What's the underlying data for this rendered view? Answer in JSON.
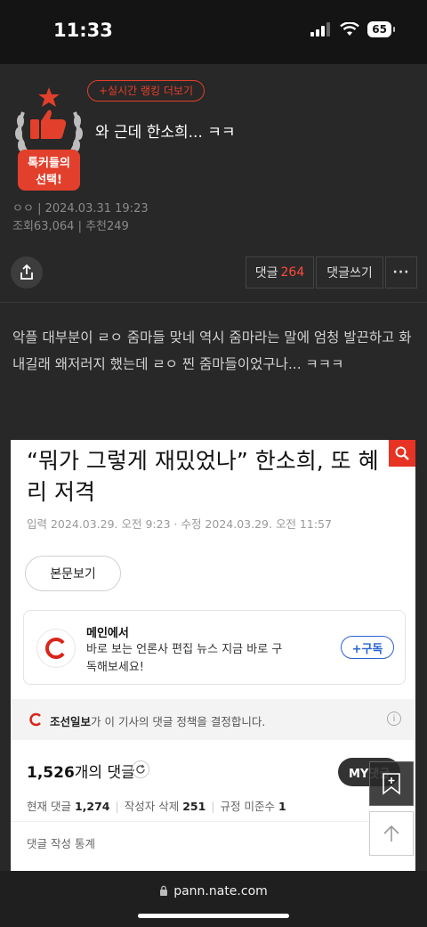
{
  "status_bar": {
    "time": "11:33",
    "battery": "65"
  },
  "header": {
    "ranking_link": "+실시간 랭킹 더보기",
    "badge_text": [
      "톡커들의",
      "선택!"
    ],
    "title": "와 근데 한소희... ㅋㅋ",
    "author": "ㅇㅇ",
    "date": "2024.03.31 19:23",
    "views_label": "조회",
    "views": "63,064",
    "recommend_label": "추천",
    "recommend": "249"
  },
  "actions": {
    "comments_label": "댓글",
    "comments_count": "264",
    "write_label": "댓글쓰기",
    "more_label": "···"
  },
  "body": {
    "text": "악플 대부분이 ㄹㅇ 줌마들 맞네 역시 줌마라는 말에 엄청 발끈하고 화내길래 왜저러지 했는데 ㄹㅇ 찐 줌마들이었구나... ㅋㅋㅋ"
  },
  "embedded_article": {
    "headline": "“뭐가 그렇게 재밌었나” 한소희, 또 혜리 저격",
    "dates": "입력 2024.03.29. 오전 9:23 · 수정 2024.03.29. 오전 11:57",
    "original_button": "본문보기",
    "card_title": "메인에서",
    "card_desc": "바로 보는 언론사 편집 뉴스 지금 바로 구독해보세요!",
    "subscribe": "+구독",
    "policy_press": "조선일보",
    "policy_text": "가 이 기사의 댓글 정책을 결정합니다.",
    "info_icon": "i",
    "comment_count_num": "1,526",
    "comment_count_suffix": "개의 댓글",
    "my_button": "MY댓글",
    "stats": {
      "current_label": "현재 댓글",
      "current": "1,274",
      "deleted_label": "작성자 삭제",
      "deleted": "251",
      "violation_label": "규정 미준수",
      "violation": "1"
    },
    "stats_title": "댓글 작성 통계"
  },
  "bottom_bar": {
    "url": "pann.nate.com"
  },
  "colors": {
    "accent": "#e2402c",
    "background": "#282828",
    "highlight": "#ff4a3a"
  }
}
